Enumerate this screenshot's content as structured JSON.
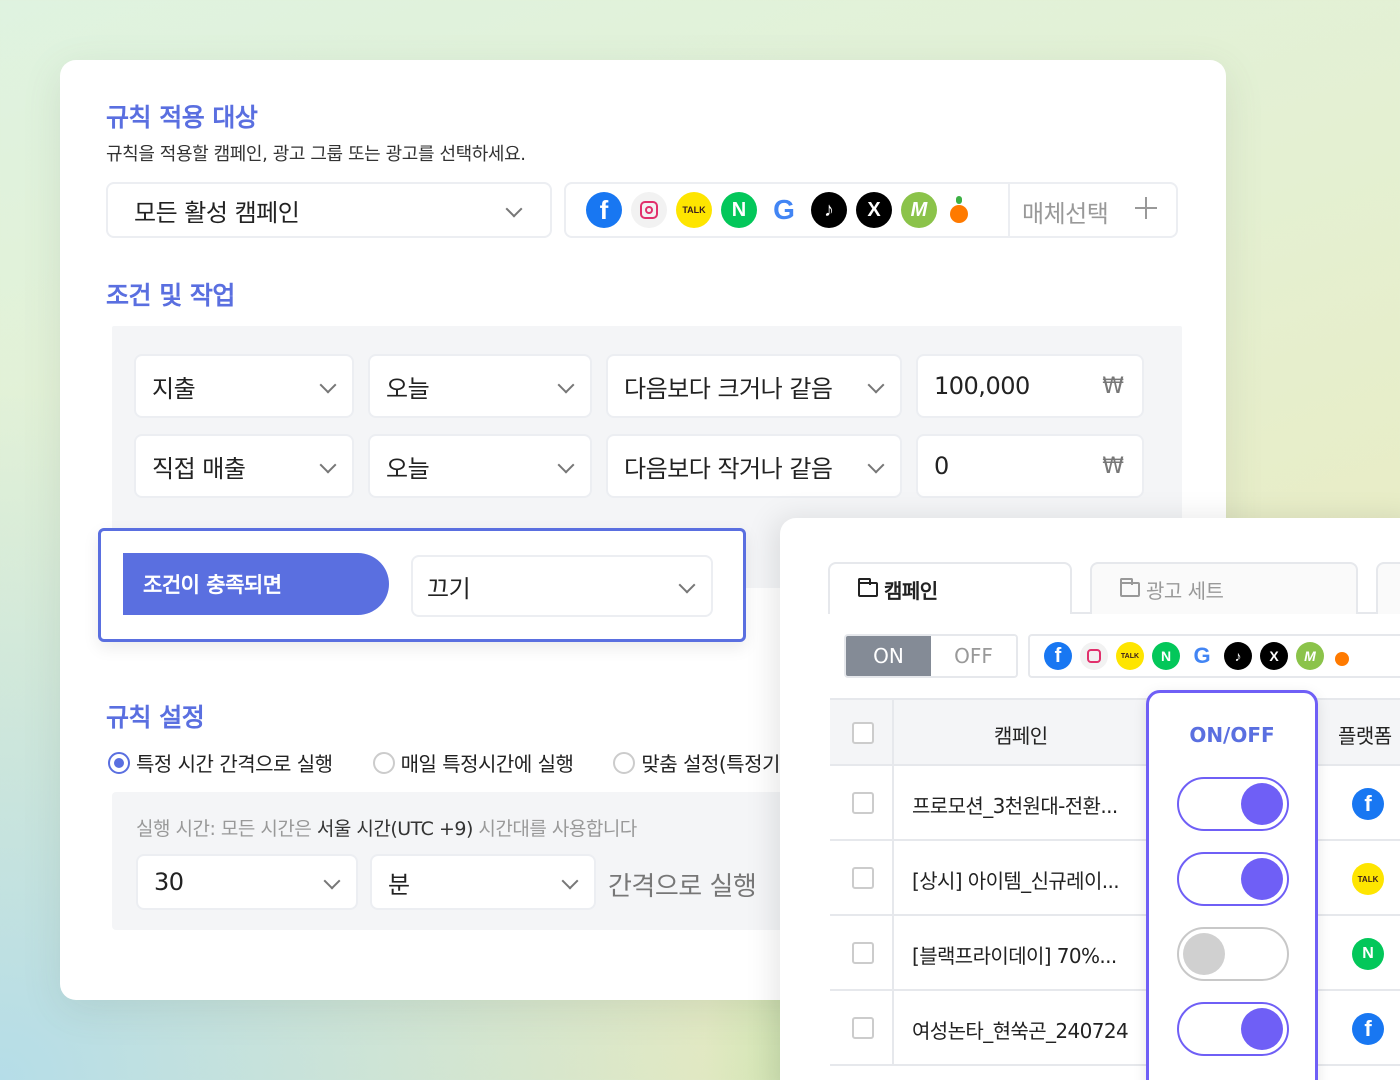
{
  "rule_target": {
    "title": "규칙 적용 대상",
    "description": "규칙을 적용할 캠페인, 광고 그룹 또는 광고를 선택하세요.",
    "campaign_select": "모든 활성 캠페인",
    "media_select_label": "매체선택",
    "media_icons": [
      "facebook-icon",
      "instagram-icon",
      "kakaotalk-icon",
      "naver-icon",
      "google-icon",
      "tiktok-icon",
      "x-icon",
      "moloco-icon",
      "carrot-icon"
    ]
  },
  "conditions": {
    "title": "조건 및 작업",
    "rows": [
      {
        "metric": "지출",
        "period": "오늘",
        "operator": "다음보다 크거나 같음",
        "value": "100,000",
        "unit": "₩"
      },
      {
        "metric": "직접 매출",
        "period": "오늘",
        "operator": "다음보다 작거나 같음",
        "value": "0",
        "unit": "₩"
      }
    ],
    "trigger_label": "조건이 충족되면",
    "action": "끄기"
  },
  "rule_settings": {
    "title": "규칙 설정",
    "options": [
      "특정 시간 간격으로 실행",
      "매일 특정시간에 실행",
      "맞춤 설정(특정기"
    ],
    "selected_index": 0,
    "note_prefix": "실행 시간: 모든 시간은 ",
    "note_highlight": "서울 시간(UTC +9)",
    "note_suffix": " 시간대를 사용합니다",
    "interval_value": "30",
    "interval_unit": "분",
    "interval_suffix": "간격으로 실행"
  },
  "campaign_panel": {
    "tabs": [
      "캠페인",
      "광고 세트"
    ],
    "toggle": {
      "on": "ON",
      "off": "OFF",
      "selected": "ON"
    },
    "headers": {
      "campaign": "캠페인",
      "onoff": "ON/OFF",
      "platform": "플랫폼"
    },
    "rows": [
      {
        "name": "프로모션_3천원대-전환...",
        "on": true,
        "platform": "facebook-icon"
      },
      {
        "name": "[상시] 아이템_신규레이...",
        "on": true,
        "platform": "kakaotalk-icon"
      },
      {
        "name": "[블랙프라이데이] 70%...",
        "on": false,
        "platform": "naver-icon"
      },
      {
        "name": "여성논타_현쑥곤_240724",
        "on": true,
        "platform": "facebook-icon"
      }
    ]
  },
  "colors": {
    "accent": "#5a6fe0",
    "toggle": "#6f5ff6",
    "facebook": "#1877f2",
    "kakao": "#fee500",
    "naver": "#03c75a"
  }
}
